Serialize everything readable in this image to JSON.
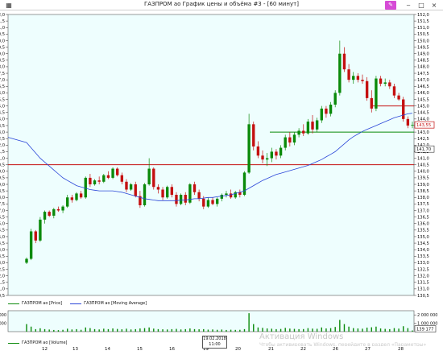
{
  "window": {
    "title": "ГАЗПРОМ ао График цены и объёма #3 - [60 минут]",
    "left_icon": "grid-icon",
    "pen_icon": "pen-icon",
    "minimize_glyph": "‒",
    "maximize_glyph": "□",
    "close_glyph": "×",
    "pen_glyph": "✎",
    "left_glyph": "▦"
  },
  "legend": {
    "price": "ГАЗПРОМ ао [Price]",
    "ma": "ГАЗПРОМ ао [Moving Average]",
    "volume": "ГАЗПРОМ ао [Volume]"
  },
  "colors": {
    "background": "#eefefe",
    "up": "#0a8a0a",
    "down": "#c41010",
    "ma": "#2a46d8",
    "hline_red": "#c41010",
    "hline_green": "#0a8a0a",
    "volume_bar": "#0a8a0a"
  },
  "price_labels": {
    "last_price": "143,55",
    "ma_value": "141,70"
  },
  "volume_labels": {
    "last_volume": "139 177",
    "left_top": "2 000 000",
    "left_mid": "1 000 000"
  },
  "date_tip": {
    "date": "19.02.2018",
    "time": "11:00"
  },
  "watermark": {
    "title": "Активация Windows",
    "subtitle": "Чтобы активировать Windows, перейдите в раздел «Параметры»"
  },
  "x_axis": {
    "labels": [
      "12",
      "13",
      "14",
      "15",
      "16",
      "19",
      "20",
      "21",
      "22",
      "26",
      "27",
      "28"
    ]
  },
  "chart_data": {
    "type": "candlestick",
    "title": "ГАЗПРОМ ао График цены и объёма #3 - [60 минут]",
    "ylim": [
      130.5,
      152.0
    ],
    "y_tick_step": 0.5,
    "y_ticks": [
      "130,5",
      "131,0",
      "131,5",
      "132,0",
      "132,5",
      "133,0",
      "133,5",
      "134,0",
      "134,5",
      "135,0",
      "135,5",
      "136,0",
      "136,5",
      "137,0",
      "137,5",
      "138,0",
      "138,5",
      "139,0",
      "139,5",
      "140,0",
      "140,5",
      "141,0",
      "141,5",
      "142,0",
      "142,5",
      "143,0",
      "143,5",
      "144,0",
      "144,5",
      "145,0",
      "145,5",
      "146,0",
      "146,5",
      "147,0",
      "147,5",
      "148,0",
      "148,5",
      "149,0",
      "149,5",
      "150,0",
      "150,5",
      "151,0",
      "151,5",
      "152,0"
    ],
    "horizontal_lines": [
      {
        "y": 140.5,
        "color": "red",
        "span": "full"
      },
      {
        "y": 143.0,
        "color": "green",
        "span": "right"
      },
      {
        "y": 145.0,
        "color": "red",
        "span": "right-short"
      }
    ],
    "candles": [
      [
        133.0,
        133.4,
        132.9,
        133.3
      ],
      [
        133.3,
        135.6,
        133.2,
        135.4
      ],
      [
        135.4,
        135.5,
        134.5,
        134.7
      ],
      [
        134.7,
        136.5,
        134.6,
        136.3
      ],
      [
        136.3,
        137.0,
        136.0,
        136.9
      ],
      [
        136.9,
        137.0,
        136.5,
        136.6
      ],
      [
        136.6,
        137.2,
        136.4,
        137.1
      ],
      [
        137.1,
        137.3,
        136.9,
        137.0
      ],
      [
        137.0,
        137.4,
        136.8,
        137.3
      ],
      [
        137.3,
        138.2,
        137.2,
        138.0
      ],
      [
        138.0,
        138.2,
        137.6,
        137.8
      ],
      [
        137.8,
        138.4,
        137.7,
        138.3
      ],
      [
        138.3,
        138.5,
        137.9,
        138.0
      ],
      [
        138.0,
        139.6,
        137.9,
        139.5
      ],
      [
        139.5,
        139.8,
        138.8,
        139.0
      ],
      [
        139.0,
        139.4,
        138.9,
        139.3
      ],
      [
        139.3,
        139.6,
        139.0,
        139.2
      ],
      [
        139.2,
        139.8,
        139.1,
        139.7
      ],
      [
        139.7,
        140.0,
        139.4,
        139.5
      ],
      [
        139.5,
        140.3,
        139.4,
        140.2
      ],
      [
        140.2,
        140.3,
        139.6,
        139.7
      ],
      [
        139.7,
        139.9,
        139.0,
        139.2
      ],
      [
        139.2,
        139.4,
        138.4,
        138.6
      ],
      [
        138.6,
        139.1,
        138.5,
        139.0
      ],
      [
        139.0,
        139.2,
        138.0,
        138.1
      ],
      [
        138.1,
        138.5,
        137.2,
        137.4
      ],
      [
        137.4,
        139.1,
        137.3,
        139.0
      ],
      [
        139.0,
        141.0,
        138.9,
        140.2
      ],
      [
        140.2,
        140.3,
        138.6,
        138.8
      ],
      [
        138.8,
        139.0,
        138.3,
        138.6
      ],
      [
        138.6,
        138.8,
        137.8,
        138.0
      ],
      [
        138.0,
        138.9,
        137.9,
        138.8
      ],
      [
        138.8,
        139.0,
        138.0,
        138.2
      ],
      [
        138.2,
        138.4,
        137.3,
        137.5
      ],
      [
        137.5,
        138.3,
        137.4,
        138.2
      ],
      [
        138.2,
        138.4,
        137.4,
        137.6
      ],
      [
        137.6,
        139.1,
        137.5,
        139.0
      ],
      [
        139.0,
        139.2,
        138.2,
        138.4
      ],
      [
        138.4,
        138.6,
        137.7,
        137.9
      ],
      [
        137.9,
        138.1,
        137.1,
        137.3
      ],
      [
        137.3,
        138.0,
        137.2,
        137.8
      ],
      [
        137.8,
        138.0,
        137.4,
        137.5
      ],
      [
        137.5,
        138.0,
        137.3,
        137.9
      ],
      [
        137.9,
        138.3,
        137.7,
        138.2
      ],
      [
        138.2,
        138.5,
        138.0,
        138.3
      ],
      [
        138.3,
        138.6,
        137.9,
        138.0
      ],
      [
        138.0,
        138.5,
        137.9,
        138.4
      ],
      [
        138.4,
        138.6,
        138.0,
        138.2
      ],
      [
        138.2,
        140.0,
        138.1,
        139.9
      ],
      [
        139.9,
        144.4,
        139.8,
        143.6
      ],
      [
        143.6,
        143.8,
        141.6,
        141.9
      ],
      [
        141.9,
        142.3,
        141.0,
        141.2
      ],
      [
        141.2,
        141.6,
        140.6,
        140.9
      ],
      [
        140.9,
        141.4,
        140.4,
        141.0
      ],
      [
        141.0,
        141.8,
        140.7,
        141.5
      ],
      [
        141.5,
        141.7,
        140.9,
        141.2
      ],
      [
        141.2,
        142.0,
        141.0,
        141.8
      ],
      [
        141.8,
        142.8,
        141.6,
        142.6
      ],
      [
        142.6,
        143.0,
        141.9,
        142.2
      ],
      [
        142.2,
        143.0,
        142.0,
        142.8
      ],
      [
        142.8,
        143.3,
        142.6,
        143.1
      ],
      [
        143.1,
        143.6,
        142.7,
        142.9
      ],
      [
        142.9,
        144.0,
        142.8,
        143.8
      ],
      [
        143.8,
        144.3,
        142.9,
        143.2
      ],
      [
        143.2,
        144.1,
        143.0,
        143.9
      ],
      [
        143.9,
        145.0,
        143.7,
        144.8
      ],
      [
        144.8,
        145.0,
        144.1,
        144.4
      ],
      [
        144.4,
        145.3,
        144.2,
        145.1
      ],
      [
        145.1,
        146.2,
        144.9,
        146.0
      ],
      [
        146.0,
        150.0,
        145.8,
        149.0
      ],
      [
        149.0,
        149.5,
        147.6,
        147.8
      ],
      [
        147.8,
        148.2,
        146.8,
        147.0
      ],
      [
        147.0,
        147.6,
        146.7,
        147.3
      ],
      [
        147.3,
        147.5,
        146.8,
        147.0
      ],
      [
        147.0,
        147.4,
        146.7,
        146.9
      ],
      [
        146.9,
        147.2,
        145.4,
        145.6
      ],
      [
        145.6,
        146.2,
        144.5,
        144.8
      ],
      [
        144.8,
        147.3,
        144.6,
        147.1
      ],
      [
        147.1,
        147.3,
        146.5,
        146.7
      ],
      [
        146.7,
        147.1,
        146.5,
        146.8
      ],
      [
        146.8,
        147.0,
        146.3,
        146.5
      ],
      [
        146.5,
        146.7,
        145.6,
        145.8
      ],
      [
        145.8,
        146.0,
        145.4,
        145.5
      ],
      [
        145.5,
        145.7,
        143.8,
        144.0
      ],
      [
        144.0,
        144.2,
        143.3,
        143.5
      ],
      [
        143.5,
        143.8,
        143.3,
        143.55
      ]
    ],
    "moving_average": [
      142.2,
      141.8,
      141.4,
      141.0,
      140.7,
      140.4,
      140.1,
      139.8,
      139.5,
      139.3,
      139.1,
      138.9,
      138.8,
      138.7,
      138.6,
      138.55,
      138.5,
      138.5,
      138.5,
      138.5,
      138.45,
      138.4,
      138.3,
      138.2,
      138.1,
      138.0,
      137.9,
      137.85,
      137.8,
      137.75,
      137.75,
      137.75,
      137.75,
      137.75,
      137.8,
      137.8,
      137.85,
      137.9,
      137.9,
      137.95,
      138.0,
      138.0,
      138.05,
      138.1,
      138.15,
      138.2,
      138.3,
      138.4,
      138.5,
      138.7,
      138.9,
      139.1,
      139.3,
      139.45,
      139.6,
      139.75,
      139.85,
      139.95,
      140.05,
      140.15,
      140.25,
      140.35,
      140.45,
      140.6,
      140.75,
      140.9,
      141.1,
      141.3,
      141.5,
      141.8,
      142.1,
      142.4,
      142.65,
      142.85,
      143.05,
      143.2,
      143.35,
      143.5,
      143.65,
      143.8,
      143.95,
      144.1,
      144.2,
      144.3,
      144.4,
      144.45
    ],
    "volume_ylim": [
      0,
      2500000
    ],
    "volumes": [
      900000,
      600000,
      300000,
      400000,
      300000,
      250000,
      200000,
      180000,
      220000,
      350000,
      260000,
      300000,
      220000,
      500000,
      420000,
      300000,
      260000,
      350000,
      300000,
      380000,
      320000,
      280000,
      350000,
      260000,
      300000,
      380000,
      420000,
      500000,
      360000,
      300000,
      280000,
      260000,
      300000,
      330000,
      260000,
      300000,
      380000,
      300000,
      280000,
      300000,
      240000,
      260000,
      220000,
      250000,
      200000,
      230000,
      210000,
      220000,
      300000,
      2200000,
      900000,
      500000,
      450000,
      380000,
      350000,
      300000,
      320000,
      450000,
      360000,
      330000,
      300000,
      310000,
      420000,
      360000,
      340000,
      500000,
      380000,
      420000,
      560000,
      1400000,
      900000,
      600000,
      420000,
      380000,
      350000,
      480000,
      520000,
      600000,
      380000,
      330000,
      300000,
      420000,
      360000,
      650000,
      420000,
      139177
    ]
  }
}
